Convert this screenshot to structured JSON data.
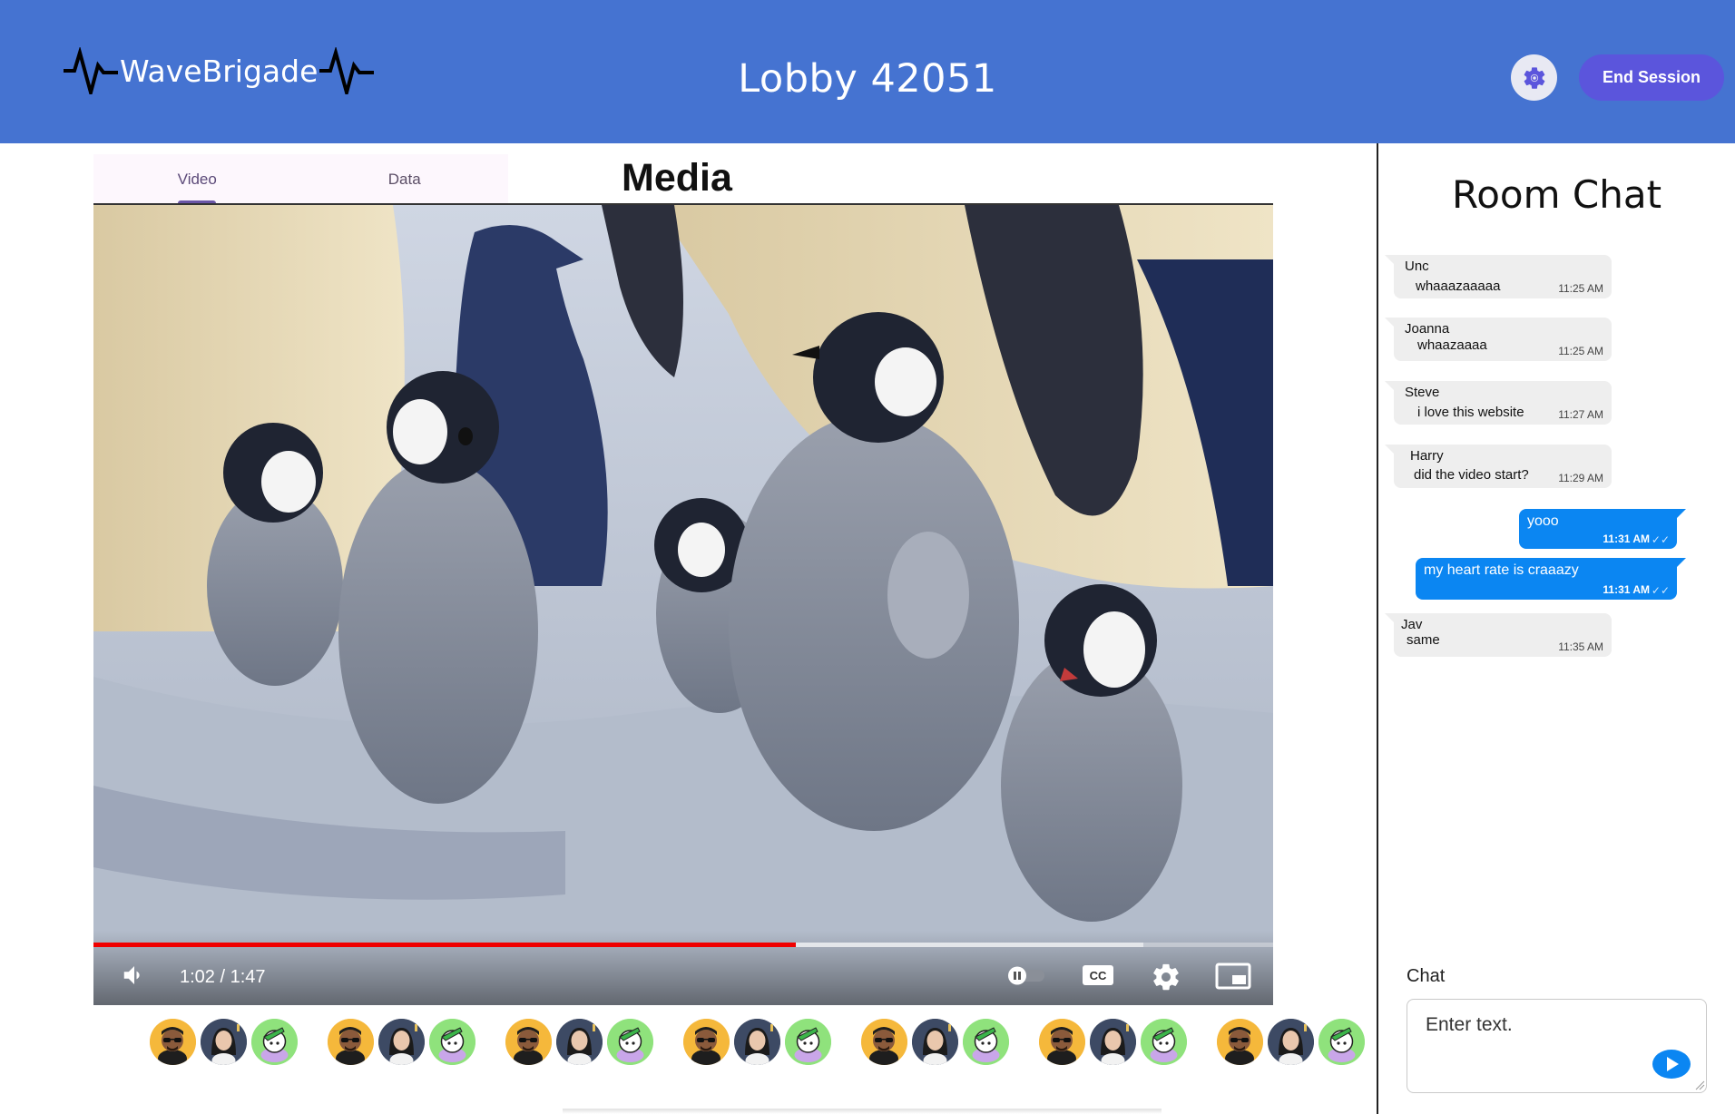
{
  "header": {
    "logo_text": "WaveBrigade",
    "lobby_title": "Lobby 42051",
    "settings_icon": "gear-icon",
    "end_session_label": "End Session",
    "bg_color": "#4573d1",
    "accent_color": "#5b55dc"
  },
  "tabs": [
    {
      "label": "Video",
      "active": true
    },
    {
      "label": "Data",
      "active": false
    }
  ],
  "media_title": "Media",
  "player": {
    "time_display": "1:02 / 1:47",
    "played_fraction": 0.595,
    "buffered_fraction": 0.89,
    "progress_color": "#f00000",
    "icons": [
      "volume-icon",
      "autoplay-toggle-icon",
      "captions-icon",
      "settings-gear-icon",
      "miniplayer-icon"
    ]
  },
  "participants": [
    "avatar-sunglasses",
    "avatar-woman",
    "avatar-cartoon",
    "avatar-sunglasses",
    "avatar-woman",
    "avatar-cartoon",
    "avatar-sunglasses",
    "avatar-woman",
    "avatar-cartoon",
    "avatar-sunglasses",
    "avatar-woman",
    "avatar-cartoon",
    "avatar-sunglasses",
    "avatar-woman",
    "avatar-cartoon",
    "avatar-sunglasses",
    "avatar-woman",
    "avatar-cartoon",
    "avatar-sunglasses",
    "avatar-woman",
    "avatar-cartoon"
  ],
  "chat": {
    "title": "Room Chat",
    "messages": [
      {
        "sender": "Unc",
        "text": "whaaazaaaaa",
        "time": "11:25 AM"
      },
      {
        "sender": "Joanna",
        "text": "whaazaaaa",
        "time": "11:25 AM"
      },
      {
        "sender": "Steve",
        "text": "i love this website",
        "time": "11:27 AM"
      },
      {
        "sender": "Harry",
        "text": "did the video start?",
        "time": "11:29 AM"
      },
      {
        "sender": "",
        "text": "yooo",
        "time": "11:31 AM",
        "outgoing": true
      },
      {
        "sender": "",
        "text": "my heart rate is craaazy",
        "time": "11:31 AM",
        "outgoing": true
      },
      {
        "sender": "Jav",
        "text": "same",
        "time": "11:35 AM"
      }
    ],
    "input_label": "Chat",
    "input_placeholder": "Enter text.",
    "send_icon": "send-icon",
    "outgoing_color": "#0b86f2"
  }
}
